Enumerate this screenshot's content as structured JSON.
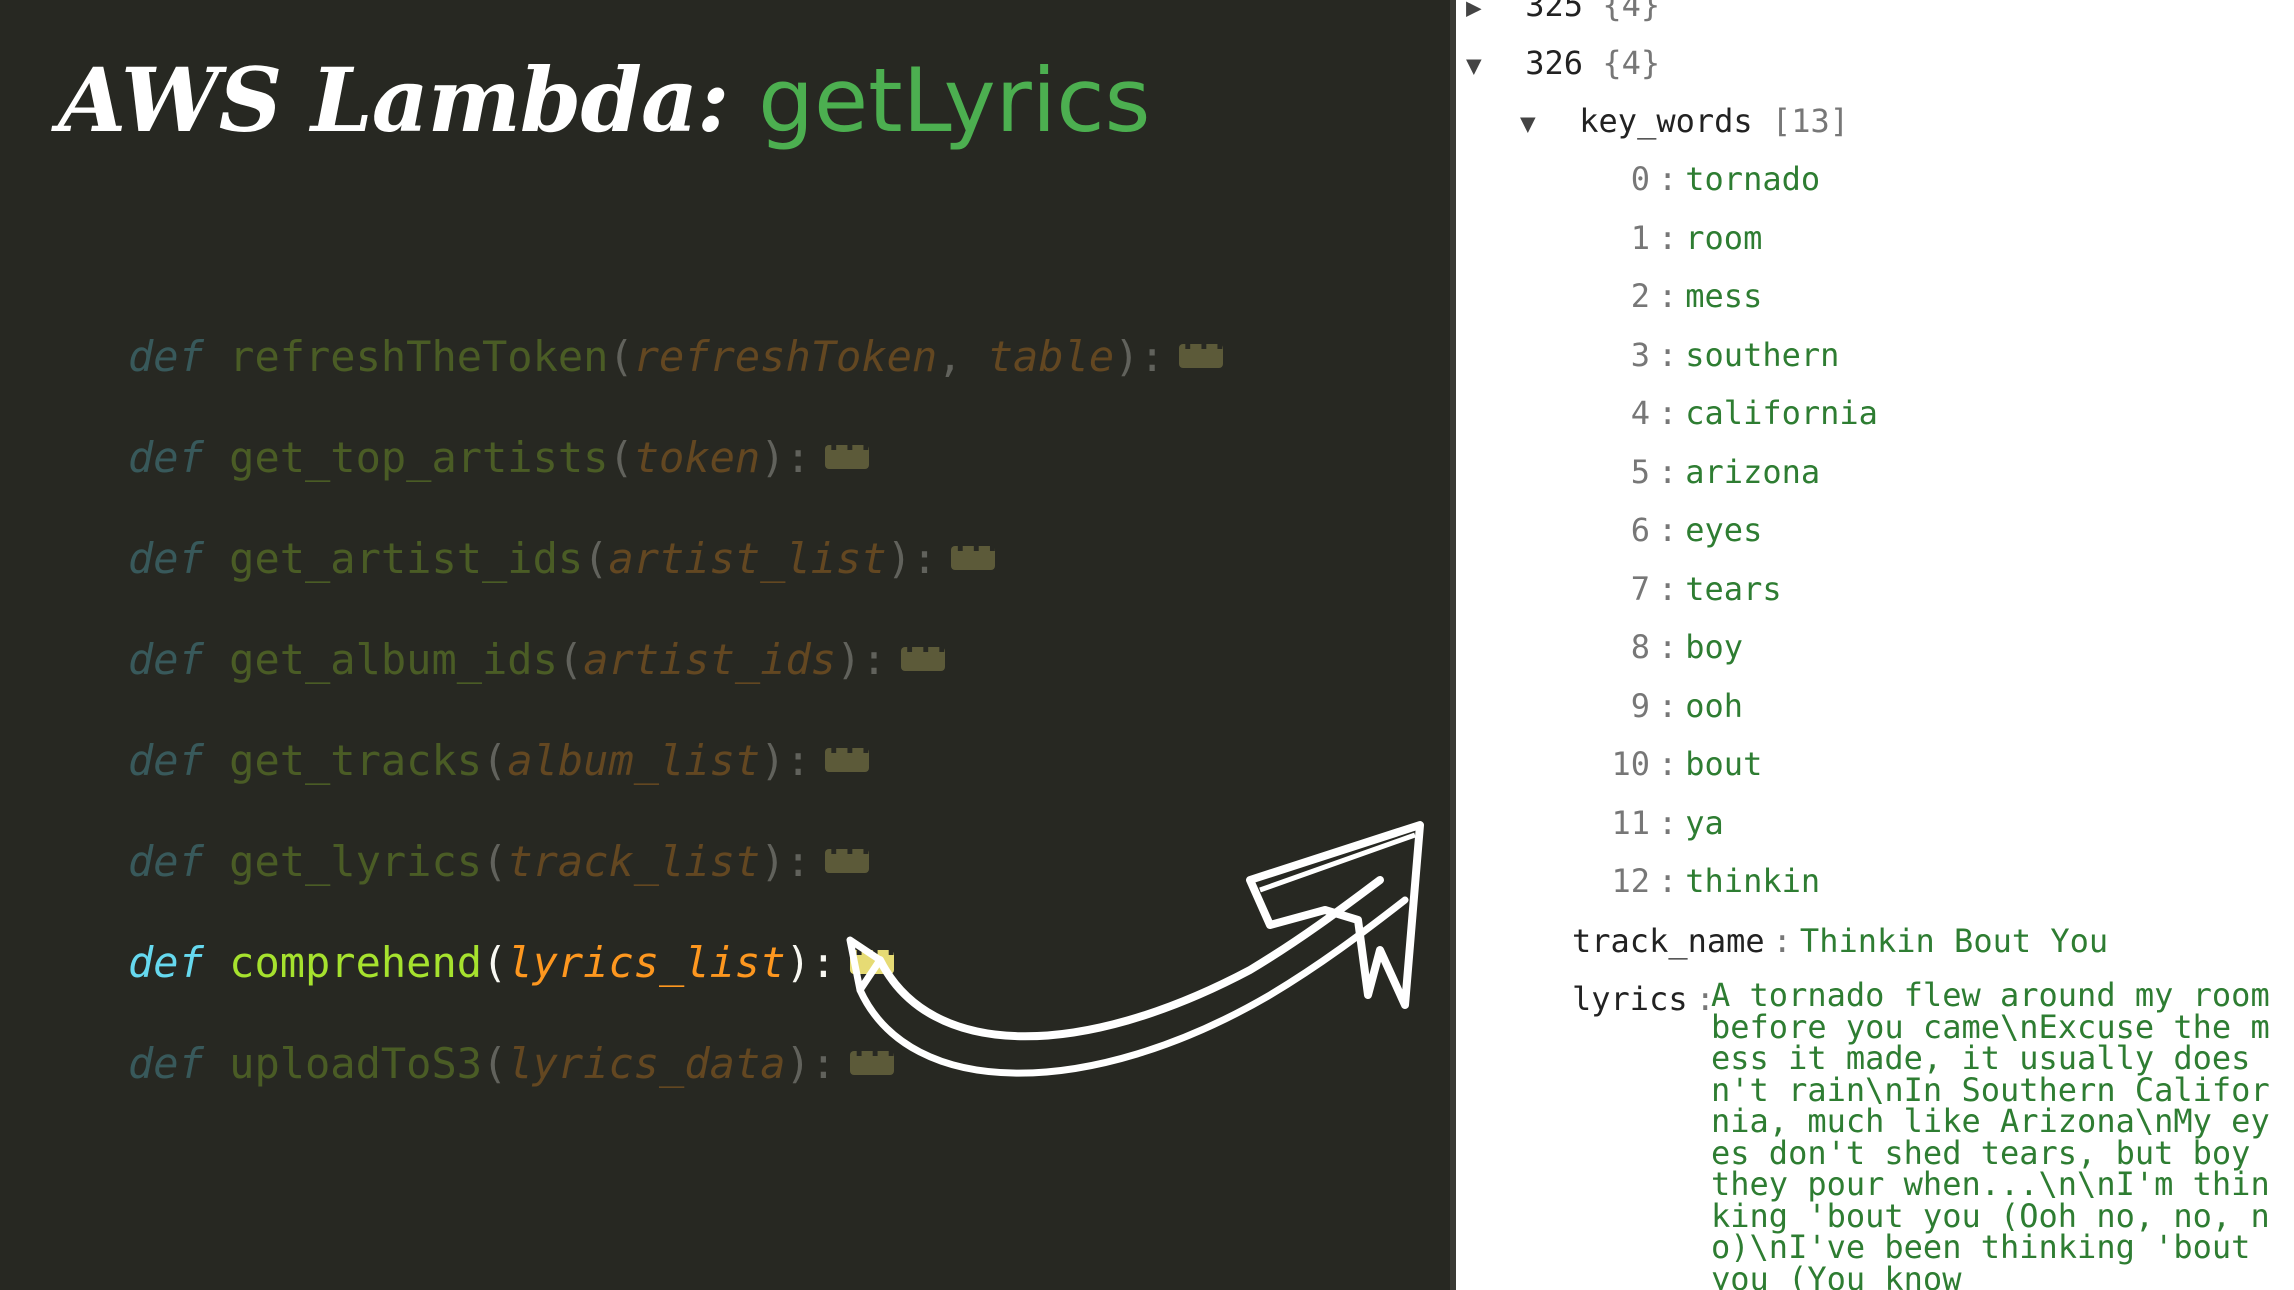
{
  "title": {
    "main": "AWS Lambda:",
    "accent": "getLyrics"
  },
  "code": {
    "keyword": "def",
    "functions": [
      {
        "name": "refreshTheToken",
        "params": [
          "refreshToken",
          "table"
        ],
        "active": false
      },
      {
        "name": "get_top_artists",
        "params": [
          "token"
        ],
        "active": false
      },
      {
        "name": "get_artist_ids",
        "params": [
          "artist_list"
        ],
        "active": false
      },
      {
        "name": "get_album_ids",
        "params": [
          "artist_ids"
        ],
        "active": false
      },
      {
        "name": "get_tracks",
        "params": [
          "album_list"
        ],
        "active": false
      },
      {
        "name": "get_lyrics",
        "params": [
          "track_list"
        ],
        "active": false
      },
      {
        "name": "comprehend",
        "params": [
          "lyrics_list"
        ],
        "active": true
      },
      {
        "name": "uploadToS3",
        "params": [
          "lyrics_data"
        ],
        "active": false
      }
    ]
  },
  "json_view": {
    "prev_index": "325",
    "prev_count": "{4}",
    "current_index": "326",
    "current_count": "{4}",
    "key_words_label": "key_words",
    "key_words_count": "[13]",
    "key_words": [
      "tornado",
      "room",
      "mess",
      "southern",
      "california",
      "arizona",
      "eyes",
      "tears",
      "boy",
      "ooh",
      "bout",
      "ya",
      "thinkin"
    ],
    "track_name_label": "track_name",
    "track_name": "Thinkin Bout You",
    "lyrics_label": "lyrics",
    "lyrics": "A tornado flew around my room before you came\\nExcuse the mess it made, it usually doesn't rain\\nIn Southern California, much like Arizona\\nMy eyes don't shed tears, but boy they pour when...\\n\\nI'm thinking 'bout you (Ooh no, no, no)\\nI've been thinking 'bout you (You know"
  },
  "colors": {
    "background": "#272822",
    "accent_green": "#4caf50",
    "value_green": "#2e7d32"
  }
}
